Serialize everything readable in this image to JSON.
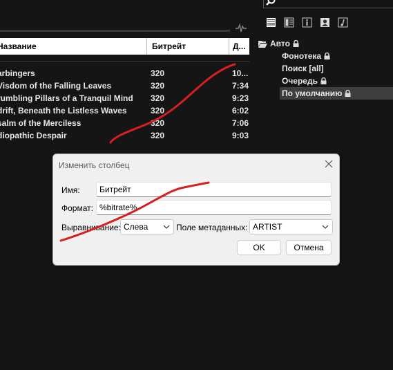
{
  "toolbar": {
    "icons": [
      "search-icon",
      "list-view-icon",
      "grid-view-icon",
      "info-view-icon",
      "artist-view-icon",
      "lyrics-view-icon"
    ]
  },
  "track_list": {
    "columns": {
      "title": "Название",
      "bitrate": "Битрейт",
      "duration": "Д..."
    },
    "rows": [
      {
        "title": "arbingers",
        "bitrate": "320",
        "duration": "10..."
      },
      {
        "title": "Visdom of the Falling Leaves",
        "bitrate": "320",
        "duration": "7:34"
      },
      {
        "title": "rumbling Pillars of a Tranquil Mind",
        "bitrate": "320",
        "duration": "9:23"
      },
      {
        "title": "drift, Beneath the Listless Waves",
        "bitrate": "320",
        "duration": "6:02"
      },
      {
        "title": "salm of the Merciless",
        "bitrate": "320",
        "duration": "7:06"
      },
      {
        "title": "diopathic Despair",
        "bitrate": "320",
        "duration": "9:03"
      }
    ]
  },
  "tree": {
    "root": "Авто",
    "items": [
      {
        "label": "Фонотека",
        "locked": true,
        "selected": false
      },
      {
        "label": "Поиск [all]",
        "locked": false,
        "selected": false
      },
      {
        "label": "Очередь",
        "locked": true,
        "selected": false
      },
      {
        "label": "По умолчанию",
        "locked": true,
        "selected": true
      }
    ]
  },
  "dialog": {
    "title": "Изменить столбец",
    "name_label": "Имя:",
    "name_value": "Битрейт",
    "format_label": "Формат:",
    "format_value": "%bitrate%",
    "align_label": "Выравнивание:",
    "align_value": "Слева",
    "meta_label": "Поле метаданных:",
    "meta_value": "ARTIST",
    "ok_label": "OK",
    "cancel_label": "Отмена"
  },
  "colors": {
    "background": "#151515",
    "annotation": "#d42020",
    "selected_row": "#3e3e3e"
  }
}
